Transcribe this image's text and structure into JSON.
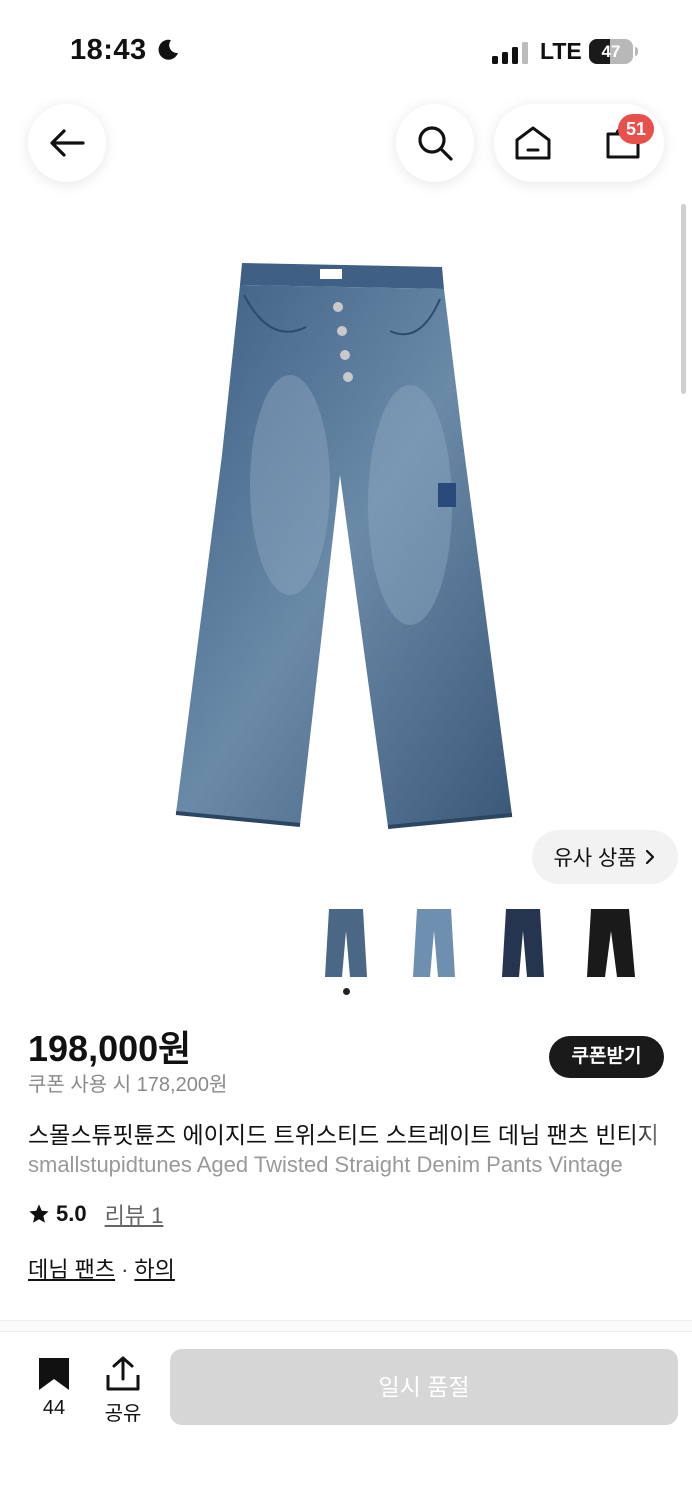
{
  "status_bar": {
    "time": "18:43",
    "network": "LTE",
    "battery": "47",
    "battery_level": 0.47
  },
  "nav": {
    "cart_count": "51"
  },
  "product": {
    "similar_label": "유사 상품",
    "price": "198,000원",
    "coupon_price": "쿠폰 사용 시 178,200원",
    "coupon_button": "쿠폰받기",
    "title_ko": "스몰스튜핏튠즈 에이지드 트위스티드 스트레이트 데님 팬츠 빈티지",
    "title_en": "smallstupidtunes Aged Twisted Straight Denim Pants Vintage",
    "rating": "5.0",
    "reviews": "리뷰 1",
    "categories": [
      "데님 팬츠",
      "하의"
    ],
    "category_sep": "·",
    "thumbnail_colors": [
      "#4a6785",
      "#6f8fb0",
      "#25344f",
      "#1a1a1a"
    ]
  },
  "bottom_bar": {
    "bookmark_count": "44",
    "share_label": "공유",
    "soldout_label": "일시 품절"
  },
  "colors": {
    "accent_badge": "#e8514b",
    "button_dark": "#1a1a1a",
    "disabled": "#d6d6d6"
  }
}
